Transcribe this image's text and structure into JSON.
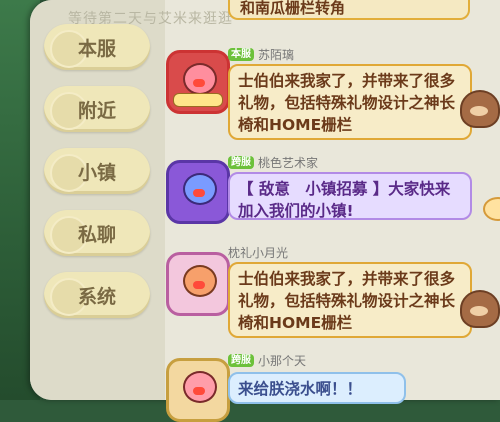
{
  "faded_text": "等待第二天与艾米来逛逛",
  "sidebar": {
    "tabs": [
      {
        "label": "本服"
      },
      {
        "label": "附近"
      },
      {
        "label": "小镇"
      },
      {
        "label": "私聊"
      },
      {
        "label": "系统"
      }
    ]
  },
  "messages": {
    "top_partial_text": "和南瓜栅栏转角",
    "items": [
      {
        "server_tag": "本服",
        "name": "苏陌璃",
        "text": "士伯伯来我家了，并带来了很多礼物，包括特殊礼物设计之神长椅和HOME栅栏"
      },
      {
        "server_tag": "跨服",
        "name": "桃色艺术家",
        "text": "【 敌意　小镇招募 】大家快来加入我们的小镇!"
      },
      {
        "server_tag": "",
        "name": "枕礼小月光",
        "text": "士伯伯来我家了，并带来了很多礼物，包括特殊礼物设计之神长椅和HOME栅栏"
      },
      {
        "server_tag": "跨服",
        "name": "小那个天",
        "text": "来给朕浇水啊！！"
      }
    ]
  }
}
